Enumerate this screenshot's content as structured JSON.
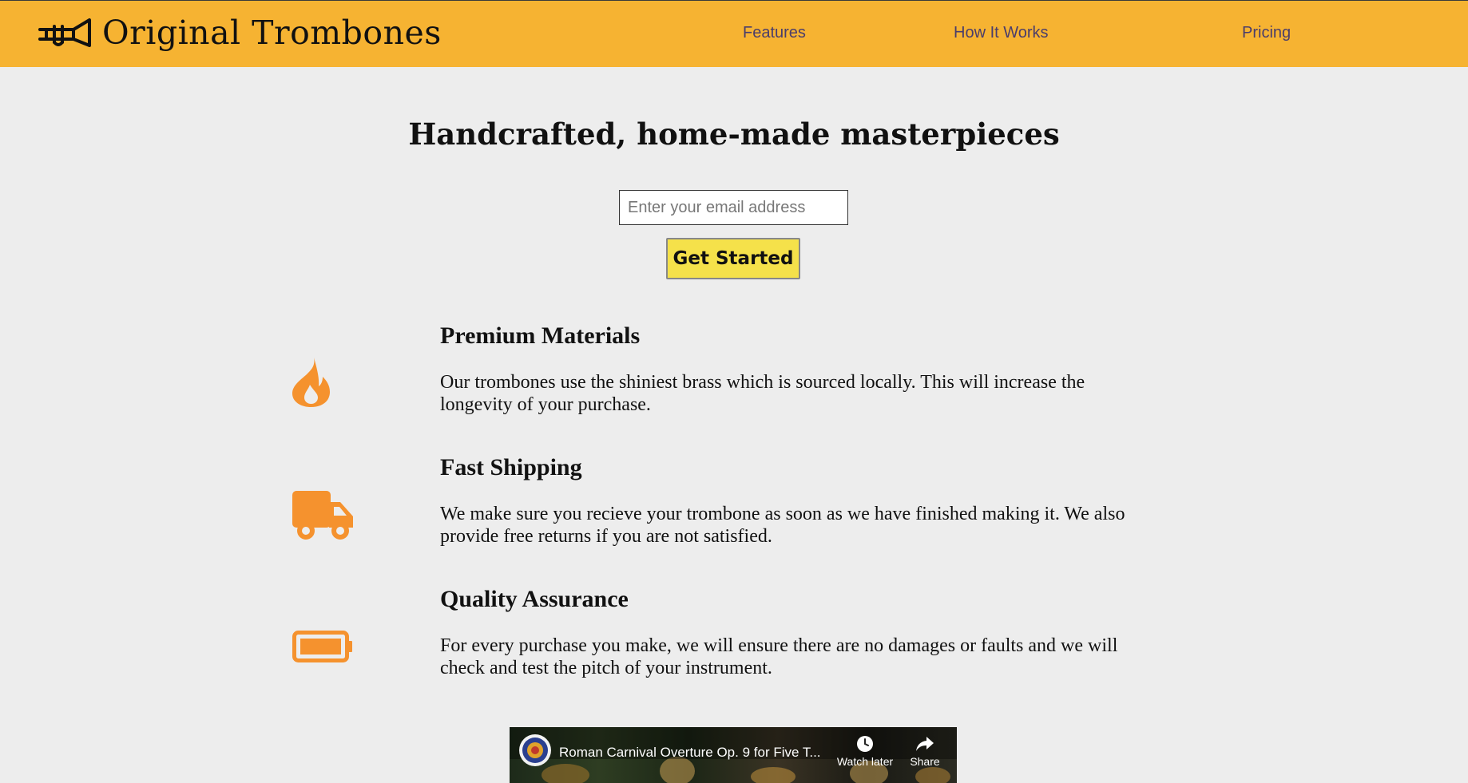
{
  "header": {
    "brand": "Original Trombones",
    "logo_icon": "trombone-icon",
    "nav": [
      {
        "label": "Features"
      },
      {
        "label": "How It Works"
      },
      {
        "label": "Pricing"
      }
    ]
  },
  "hero": {
    "title": "Handcrafted, home-made masterpieces",
    "email_placeholder": "Enter your email address",
    "email_value": "",
    "cta_label": "Get Started"
  },
  "features": [
    {
      "icon": "fire-icon",
      "title": "Premium Materials",
      "description": "Our trombones use the shiniest brass which is sourced locally. This will increase the longevity of your purchase."
    },
    {
      "icon": "truck-icon",
      "title": "Fast Shipping",
      "description": "We make sure you recieve your trombone as soon as we have finished making it. We also provide free returns if you are not satisfied."
    },
    {
      "icon": "battery-icon",
      "title": "Quality Assurance",
      "description": "For every purchase you make, we will ensure there are no damages or faults and we will check and test the pitch of your instrument."
    }
  ],
  "video": {
    "title": "Roman Carnival Overture Op. 9 for Five T...",
    "watch_later_label": "Watch later",
    "share_label": "Share",
    "watch_later_icon": "clock-icon",
    "share_icon": "share-arrow-icon"
  },
  "colors": {
    "header_bg": "#f6b332",
    "page_bg": "#ededed",
    "nav_text": "#4a3d6b",
    "icon_orange": "#f5922e",
    "cta_bg": "#f5e14a"
  }
}
